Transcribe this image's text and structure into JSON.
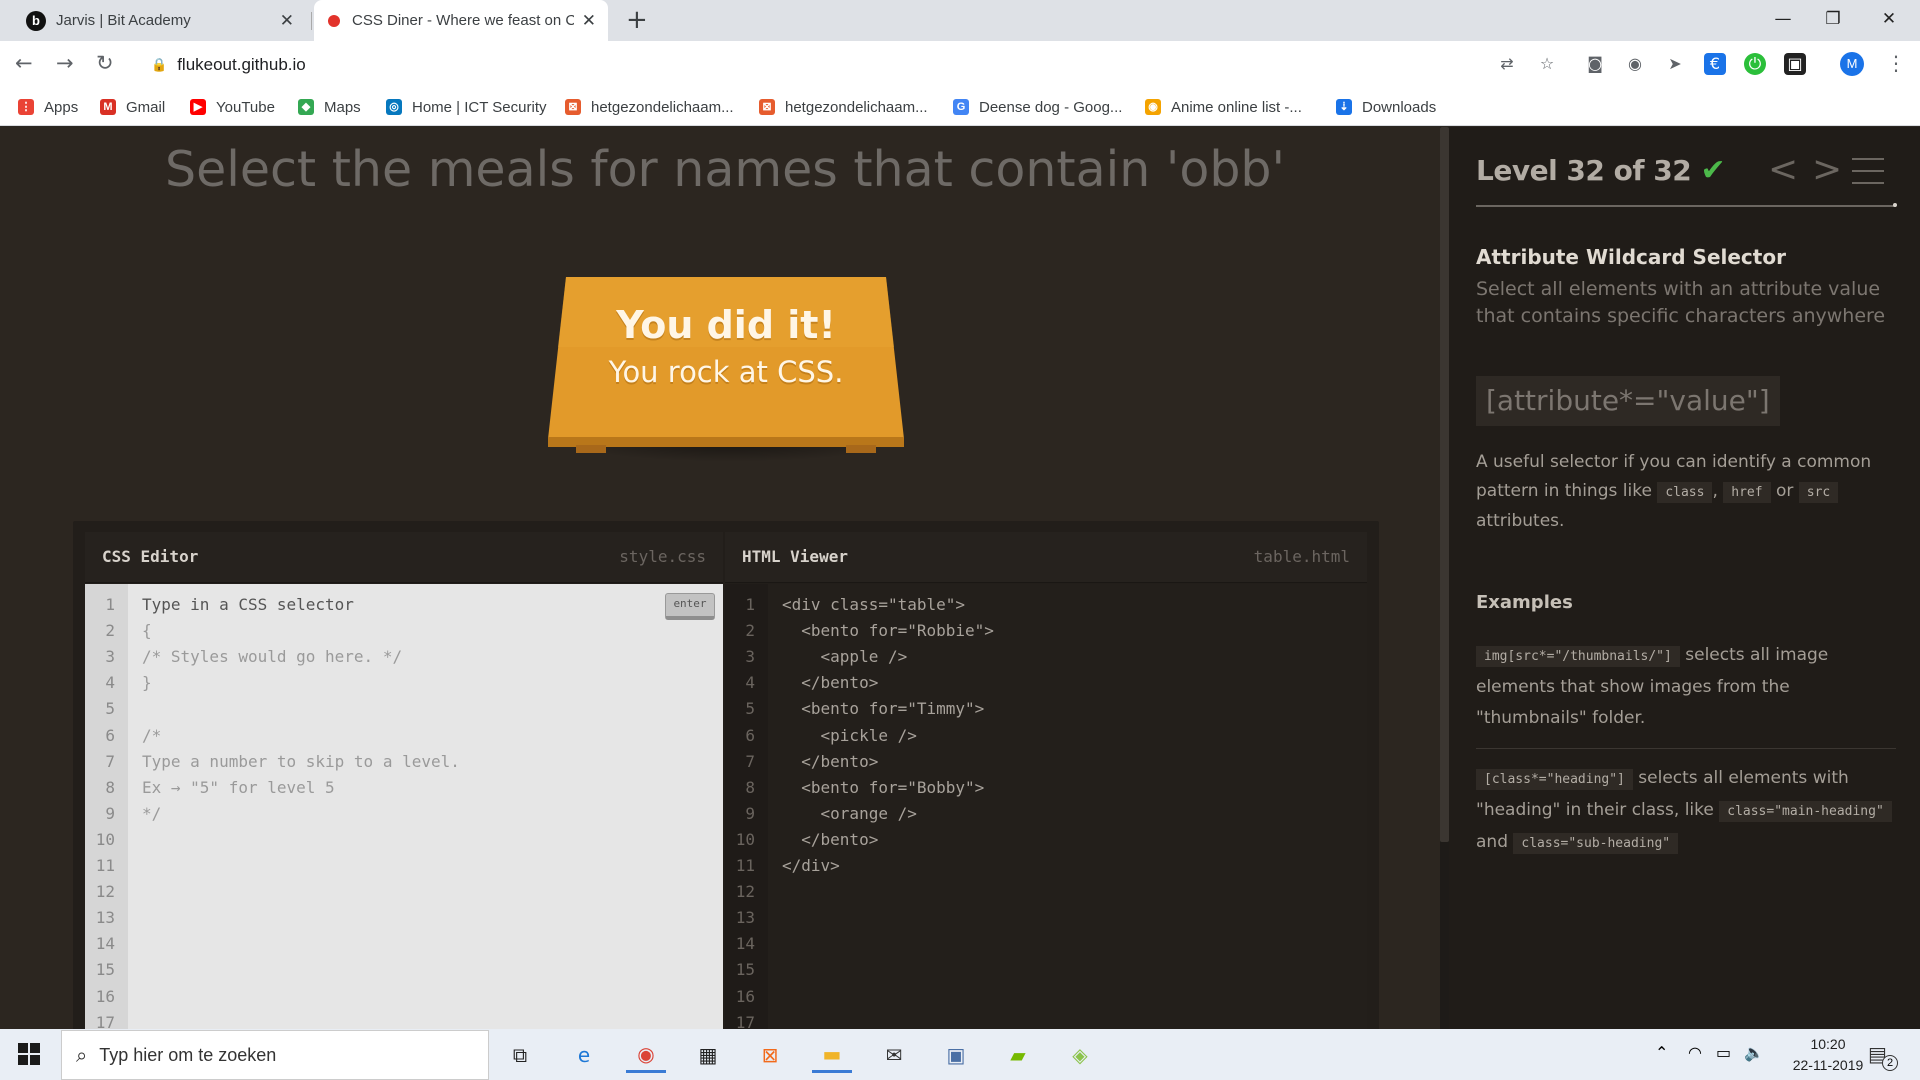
{
  "browser": {
    "tabs": [
      {
        "favicon": "b",
        "title": "Jarvis | Bit Academy",
        "active": false
      },
      {
        "favicon": "red-dot",
        "title": "CSS Diner - Where we feast on CSS",
        "active": true
      }
    ],
    "new_tab_label": "+",
    "window_controls": {
      "minimize": "—",
      "maximize": "❐",
      "close": "✕"
    },
    "url": "flukeout.github.io",
    "profile_initial": "M",
    "bookmarks": [
      {
        "icon": "apps-icon",
        "label": "Apps",
        "color": "#ea4335"
      },
      {
        "icon": "gmail-icon",
        "label": "Gmail",
        "color": "#d93025"
      },
      {
        "icon": "youtube-icon",
        "label": "YouTube",
        "color": "#ff0000"
      },
      {
        "icon": "maps-icon",
        "label": "Maps",
        "color": "#34a853"
      },
      {
        "icon": "drupal-icon",
        "label": "Home | ICT Security",
        "color": "#0678be"
      },
      {
        "icon": "site-icon",
        "label": "hetgezondelichaam...",
        "color": "#e65c2e"
      },
      {
        "icon": "site-icon",
        "label": "hetgezondelichaam...",
        "color": "#e65c2e"
      },
      {
        "icon": "google-icon",
        "label": "Deense dog - Goog...",
        "color": "#4285f4"
      },
      {
        "icon": "anime-icon",
        "label": "Anime online list -...",
        "color": "#f4a300"
      },
      {
        "icon": "download-icon",
        "label": "Downloads",
        "color": "#1a73e8"
      }
    ]
  },
  "game": {
    "order_instruction": "Select the meals for names that contain 'obb'",
    "win_title": "You did it!",
    "win_subtitle": "You rock at CSS.",
    "css_editor": {
      "title": "CSS Editor",
      "file": "style.css",
      "enter_label": "enter",
      "placeholder_line": "Type in a CSS selector",
      "lines": [
        "{",
        "/* Styles would go here. */",
        "}",
        "",
        "/*",
        "Type a number to skip to a level.",
        "Ex → \"5\" for level 5",
        "*/"
      ],
      "line_count": 17
    },
    "html_viewer": {
      "title": "HTML Viewer",
      "file": "table.html",
      "lines": [
        "<div class=\"table\">",
        "  <bento for=\"Robbie\">",
        "    <apple />",
        "  </bento>",
        "  <bento for=\"Timmy\">",
        "    <pickle />",
        "  </bento>",
        "  <bento for=\"Bobby\">",
        "    <orange />",
        "  </bento>",
        "</div>"
      ],
      "line_count": 17
    }
  },
  "sidebar": {
    "level_label": "Level 32 of 32",
    "level_check": "✔",
    "progress_fraction": 1.0,
    "prev_label": "<",
    "next_label": ">",
    "selector_name": "Attribute Wildcard Selector",
    "selector_title": "Select all elements with an attribute value that contains specific characters anywhere",
    "syntax": "[attribute*=\"value\"]",
    "hint_before": "A useful selector if you can identify a common pattern in things like",
    "hint_code_1": "class",
    "hint_sep_1": ",",
    "hint_code_2": "href",
    "hint_sep_2": "or",
    "hint_code_3": "src",
    "hint_after": "attributes.",
    "examples_heading": "Examples",
    "example1_code": "img[src*=\"/thumbnails/\"]",
    "example1_text": "selects all image elements that show images from the \"thumbnails\" folder.",
    "example2_code": "[class*=\"heading\"]",
    "example2_text": "selects all elements with \"heading\" in their class, like",
    "example2_code2": "class=\"main-heading\"",
    "example2_and": "and",
    "example2_code3": "class=\"sub-heading\""
  },
  "taskbar": {
    "search_placeholder": "Typ hier om te zoeken",
    "time": "10:20",
    "date": "22-11-2019",
    "notification_count": "2",
    "apps": [
      "task-view-icon",
      "edge-icon",
      "chrome-icon",
      "store-icon",
      "xampp-icon",
      "file-explorer-icon",
      "mail-icon",
      "network-icon",
      "nvidia-icon",
      "bluestacks-icon"
    ]
  },
  "colors": {
    "accent_check": "#4cb94a",
    "plate_orange": "#e29a2a",
    "page_bg": "#2c2620"
  }
}
